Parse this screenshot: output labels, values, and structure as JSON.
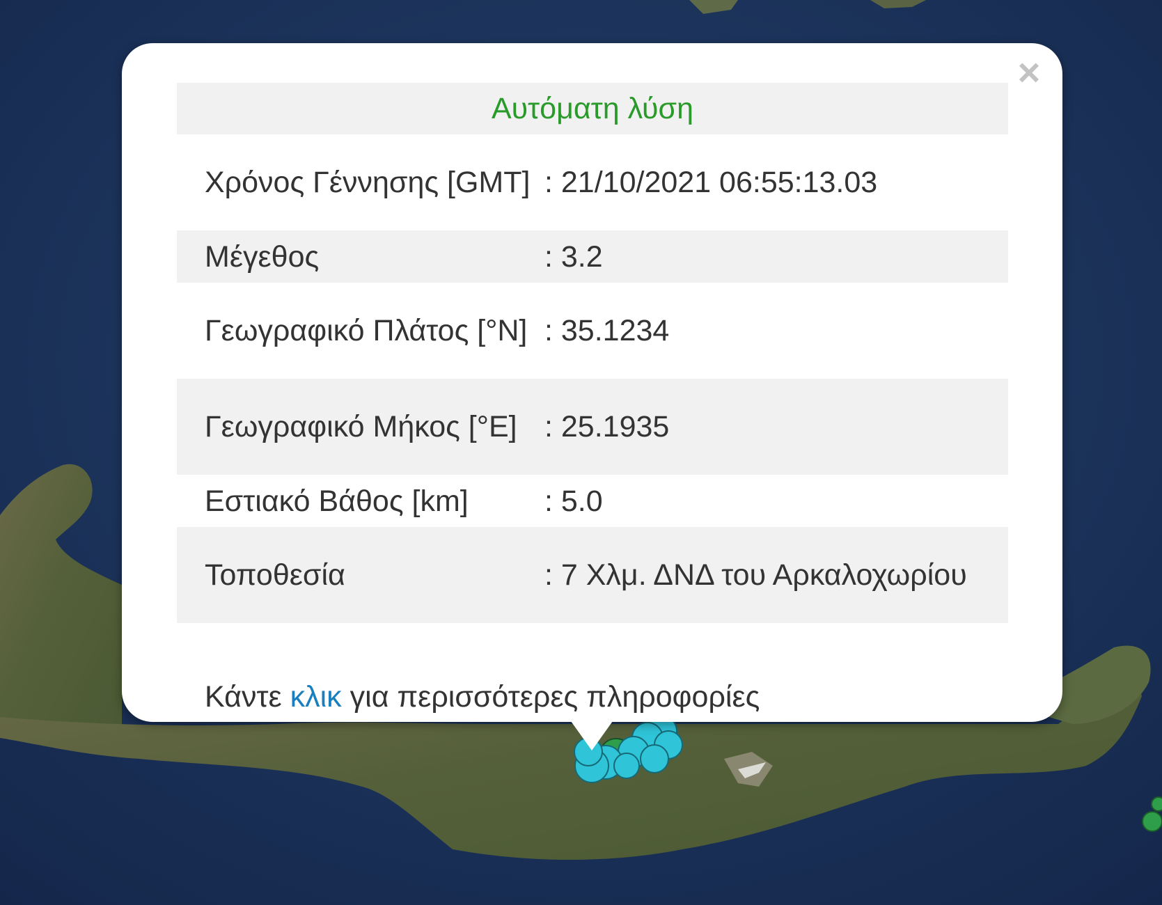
{
  "popup": {
    "title": "Αυτόματη λύση",
    "title_color": "#2a9a2a",
    "close_symbol": "×",
    "rows": [
      {
        "label": "Χρόνος Γέννησης [GMT]",
        "value": ": 21/10/2021 06:55:13.03"
      },
      {
        "label": "Μέγεθος",
        "value": ": 3.2"
      },
      {
        "label": "Γεωγραφικό Πλάτος [°N]",
        "value": ": 35.1234"
      },
      {
        "label": "Γεωγραφικό Μήκος [°E]",
        "value": ": 25.1935"
      },
      {
        "label": "Εστιακό Βάθος [km]",
        "value": ": 5.0"
      },
      {
        "label": "Τοποθεσία",
        "value": ": 7 Χλμ. ΔΝΔ του Αρκαλοχωρίου"
      }
    ],
    "footer": {
      "prefix": "Κάντε ",
      "link": "κλικ",
      "suffix": " για περισσότερες πληροφορίες",
      "link_color": "#1a7fbf"
    }
  },
  "map": {
    "marker_color_recent": "#2fc4d8",
    "marker_color_older": "#2e9e4a"
  }
}
